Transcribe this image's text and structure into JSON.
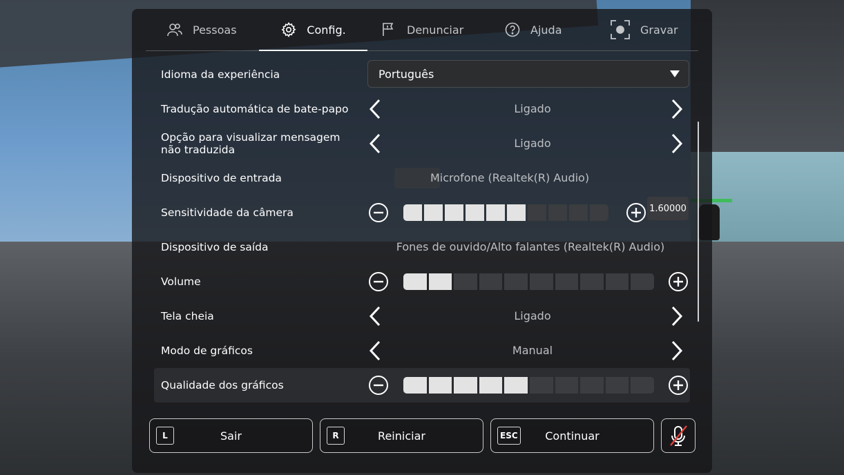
{
  "tabs": [
    {
      "label": "Pessoas",
      "icon": "people-icon",
      "active": false
    },
    {
      "label": "Config.",
      "icon": "gear-icon",
      "active": true
    },
    {
      "label": "Denunciar",
      "icon": "flag-icon",
      "active": false
    },
    {
      "label": "Ajuda",
      "icon": "help-icon",
      "active": false
    },
    {
      "label": "Gravar",
      "icon": "record-icon",
      "active": false
    }
  ],
  "settings": {
    "language": {
      "label": "Idioma da experiência",
      "value": "Português"
    },
    "chat_translation": {
      "label": "Tradução automática de bate-papo",
      "value": "Ligado"
    },
    "untranslated_view": {
      "label": "Opção para visualizar mensagem não traduzida",
      "value": "Ligado"
    },
    "input_device": {
      "label": "Dispositivo de entrada",
      "value": "Microfone (Realtek(R) Audio)"
    },
    "camera_sensitivity": {
      "label": "Sensitividade da câmera",
      "value": "1.60000",
      "level_on": 6,
      "level_total": 10
    },
    "output_device": {
      "label": "Dispositivo de saída",
      "value": "Fones de ouvido/Alto falantes (Realtek(R) Audio)"
    },
    "volume": {
      "label": "Volume",
      "level_on": 2,
      "level_total": 10
    },
    "fullscreen": {
      "label": "Tela cheia",
      "value": "Ligado"
    },
    "graphics_mode": {
      "label": "Modo de gráficos",
      "value": "Manual"
    },
    "graphics_quality": {
      "label": "Qualidade dos gráficos",
      "level_on": 5,
      "level_total": 10
    }
  },
  "buttons": {
    "leave": {
      "key": "L",
      "label": "Sair"
    },
    "reset": {
      "key": "R",
      "label": "Reiniciar"
    },
    "resume": {
      "key": "ESC",
      "label": "Continuar"
    }
  },
  "colors": {
    "accent": "#ffffff",
    "panel": "#161719",
    "segment_on": "#e3e3e3",
    "segment_off": "#3b3d40",
    "muted_slash": "#e0403a"
  }
}
